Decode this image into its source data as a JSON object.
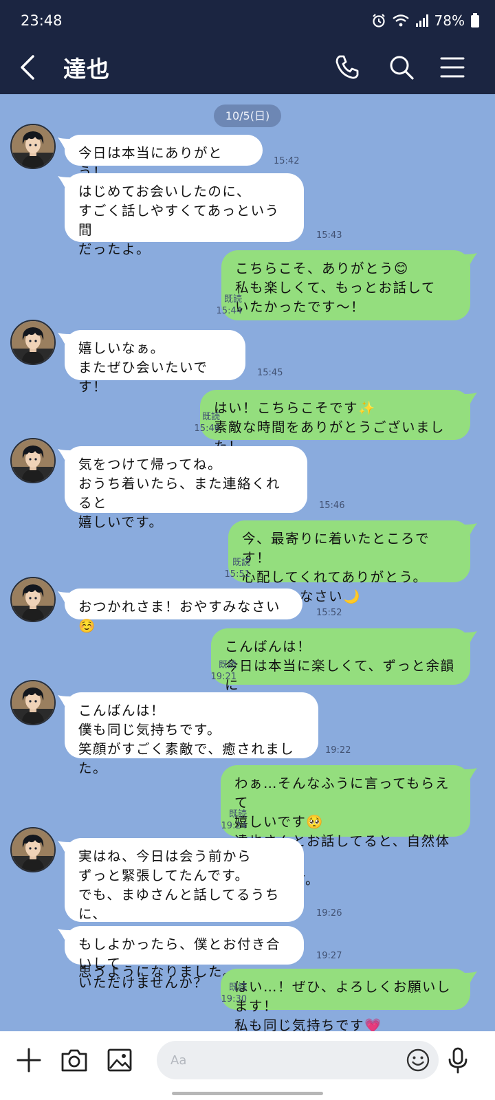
{
  "status": {
    "time": "23:48",
    "battery": "78%"
  },
  "header": {
    "title": "達也"
  },
  "date_label": "10/5(日)",
  "messages": [
    {
      "from": "them",
      "text": "今日は本当にありがとう！",
      "time": "15:42"
    },
    {
      "from": "them",
      "text": "はじめてお会いしたのに、\nすごく話しやすくてあっという間\nだったよ。",
      "time": "15:43"
    },
    {
      "from": "me",
      "text": "こちらこそ、ありがとう😊\n私も楽しくて、もっとお話して\nいたかったです〜！",
      "read": "既読",
      "time": "15:44"
    },
    {
      "from": "them",
      "text": "嬉しいなぁ。\nまたぜひ会いたいです！",
      "time": "15:45"
    },
    {
      "from": "me",
      "text": "はい！こちらこそです✨\n素敵な時間をありがとうございました！",
      "read": "既読",
      "time": "15:46"
    },
    {
      "from": "them",
      "text": "気をつけて帰ってね。\nおうち着いたら、また連絡くれると\n嬉しいです。",
      "time": "15:46"
    },
    {
      "from": "me",
      "text": "今、最寄りに着いたところです！\n心配してくれてありがとう。\nおやすみなさい🌙",
      "read": "既読",
      "time": "15:51"
    },
    {
      "from": "them",
      "text": "おつかれさま！おやすみなさい☺️",
      "time": "15:52"
    },
    {
      "from": "me",
      "text": "こんばんは！\n今日は本当に楽しくて、ずっと余韻に\n浸ってます☺️",
      "read": "既読",
      "time": "19:21"
    },
    {
      "from": "them",
      "text": "こんばんは！\n僕も同じ気持ちです。\n笑顔がすごく素敵で、癒されました。",
      "time": "19:22"
    },
    {
      "from": "me",
      "text": "わぁ…そんなふうに言ってもらえて\n嬉しいです🥺\n達也さんとお話してると、自然体で\nいられます。",
      "read": "既読",
      "time": "19:24"
    },
    {
      "from": "them",
      "text": "実はね、今日は会う前から\nずっと緊張してたんです。\nでも、まゆさんと話してるうちに、\nこの人ともっと一緒にいたいって\n思うようになりました。",
      "time": "19:26"
    },
    {
      "from": "them",
      "text": "もしよかったら、僕とお付き合いして\nいただけませんか？",
      "time": "19:27"
    },
    {
      "from": "me",
      "text": "はい…！ぜひ、よろしくお願いします！\n私も同じ気持ちです💗",
      "read": "既読",
      "time": "19:30"
    }
  ],
  "input": {
    "placeholder": "Aa"
  },
  "icons": {
    "back": "chevron-left-icon",
    "call": "phone-icon",
    "search": "search-icon",
    "menu": "hamburger-menu-icon",
    "add": "plus-icon",
    "camera": "camera-icon",
    "gallery": "image-icon",
    "emoji": "smiley-icon",
    "mic": "microphone-icon"
  },
  "colors": {
    "header": "#1b2541",
    "chat_bg": "#8aabdd",
    "bubble_in": "#ffffff",
    "bubble_out": "#94de7e"
  }
}
